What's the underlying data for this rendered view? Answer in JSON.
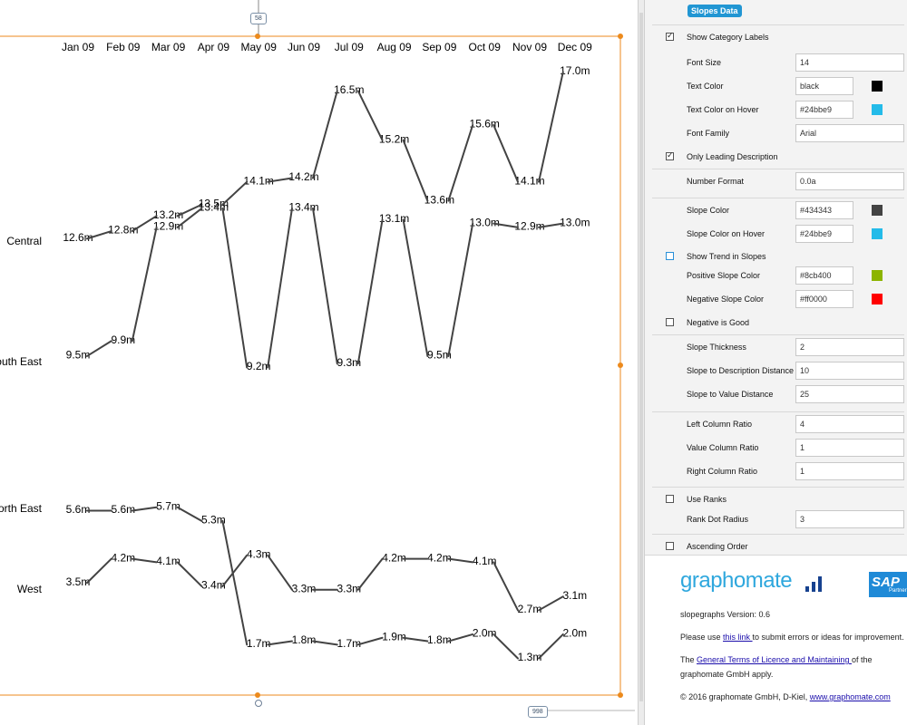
{
  "chart_data": {
    "type": "line",
    "subtype": "slopegraph",
    "categories": [
      "Jan 09",
      "Feb 09",
      "Mar 09",
      "Apr 09",
      "May 09",
      "Jun 09",
      "Jul 09",
      "Aug 09",
      "Sep 09",
      "Oct 09",
      "Nov 09",
      "Dec 09"
    ],
    "series": [
      {
        "name": "Central",
        "values": [
          12.6,
          12.8,
          13.2,
          13.5,
          14.1,
          14.2,
          16.5,
          15.2,
          13.6,
          15.6,
          14.1,
          17.0
        ],
        "labels": [
          "12.6m",
          "12.8m",
          "13.2m",
          "13.5m",
          "14.1m",
          "14.2m",
          "16.5m",
          "15.2m",
          "13.6m",
          "15.6m",
          "14.1m",
          "17.0m"
        ]
      },
      {
        "name": "South East",
        "values": [
          9.5,
          9.9,
          12.9,
          13.4,
          9.2,
          13.4,
          9.3,
          13.1,
          9.5,
          13.0,
          12.9,
          13.0
        ],
        "labels": [
          "9.5m",
          "9.9m",
          "12.9m",
          "13.4m",
          "9.2m",
          "13.4m",
          "9.3m",
          "13.1m",
          "9.5m",
          "13.0m",
          "12.9m",
          "13.0m"
        ]
      },
      {
        "name": "North East",
        "values": [
          5.6,
          5.6,
          5.7,
          5.3,
          1.7,
          1.8,
          1.7,
          1.9,
          1.8,
          2.0,
          1.3,
          2.0
        ],
        "labels": [
          "5.6m",
          "5.6m",
          "5.7m",
          "5.3m",
          "1.7m",
          "1.8m",
          "1.7m",
          "1.9m",
          "1.8m",
          "2.0m",
          "1.3m",
          "2.0m"
        ]
      },
      {
        "name": "West",
        "values": [
          3.5,
          4.2,
          4.1,
          3.4,
          4.3,
          3.3,
          3.3,
          4.2,
          4.2,
          4.1,
          2.7,
          3.1
        ],
        "labels": [
          "3.5m",
          "4.2m",
          "4.1m",
          "3.4m",
          "4.3m",
          "3.3m",
          "3.3m",
          "4.2m",
          "4.2m",
          "4.1m",
          "2.7m",
          "3.1m"
        ]
      }
    ],
    "left_labels": [
      "Central",
      "outh East",
      "orth East",
      "West"
    ],
    "slope_color": "#434343",
    "text_color": "#000000"
  },
  "canvas": {
    "top_size_badge": "58",
    "bottom_size_badge": "998"
  },
  "panel": {
    "tab_label": "Slopes Data",
    "rows": [
      {
        "kind": "check",
        "label": "Show Category Labels",
        "checked": true
      },
      {
        "kind": "input",
        "label": "Font Size",
        "value": "14"
      },
      {
        "kind": "color",
        "label": "Text Color",
        "value": "black",
        "swatch": "#000000"
      },
      {
        "kind": "color",
        "label": "Text Color on Hover",
        "value": "#24bbe9",
        "swatch": "#24bbe9"
      },
      {
        "kind": "input",
        "label": "Font Family",
        "value": "Arial"
      },
      {
        "kind": "check",
        "label": "Only Leading Description",
        "checked": true
      },
      {
        "kind": "input",
        "label": "Number Format",
        "value": "0.0a"
      },
      {
        "kind": "color",
        "label": "Slope Color",
        "value": "#434343",
        "swatch": "#434343"
      },
      {
        "kind": "color",
        "label": "Slope Color on Hover",
        "value": "#24bbe9",
        "swatch": "#24bbe9"
      },
      {
        "kind": "check",
        "label": "Show Trend in Slopes",
        "checked": false,
        "blue": true
      },
      {
        "kind": "color",
        "label": "Positive Slope Color",
        "value": "#8cb400",
        "swatch": "#8cb400"
      },
      {
        "kind": "color",
        "label": "Negative Slope Color",
        "value": "#ff0000",
        "swatch": "#ff0000"
      },
      {
        "kind": "check",
        "label": "Negative is Good",
        "checked": false
      },
      {
        "kind": "input",
        "label": "Slope Thickness",
        "value": "2"
      },
      {
        "kind": "input",
        "label": "Slope to Description Distance",
        "value": "10"
      },
      {
        "kind": "input",
        "label": "Slope to Value Distance",
        "value": "25"
      },
      {
        "kind": "input",
        "label": "Left Column Ratio",
        "value": "4"
      },
      {
        "kind": "input",
        "label": "Value Column Ratio",
        "value": "1"
      },
      {
        "kind": "input",
        "label": "Right Column Ratio",
        "value": "1"
      },
      {
        "kind": "check",
        "label": "Use Ranks",
        "checked": false
      },
      {
        "kind": "input",
        "label": "Rank Dot Radius",
        "value": "3"
      },
      {
        "kind": "check",
        "label": "Ascending Order",
        "checked": false
      }
    ],
    "check_mark": "✓"
  },
  "brand": {
    "logo_text": "graphomate",
    "sap_text": "SAP",
    "sap_sub": "Partner",
    "version": "slopegraphs Version: 0.6",
    "report_pre": "Please use ",
    "report_link": "this link ",
    "report_post": "to submit errors or ideas for improvement.",
    "terms_pre": "The ",
    "terms_link": "General Terms of Licence and Maintaining ",
    "terms_post": "of the",
    "terms_line2": "graphomate GmbH apply.",
    "copyright": "© 2016 graphomate GmbH, D-Kiel, ",
    "website": "www.graphomate.com",
    "logo_bar_color": "#17428f",
    "accent_color": "#2196d3"
  }
}
